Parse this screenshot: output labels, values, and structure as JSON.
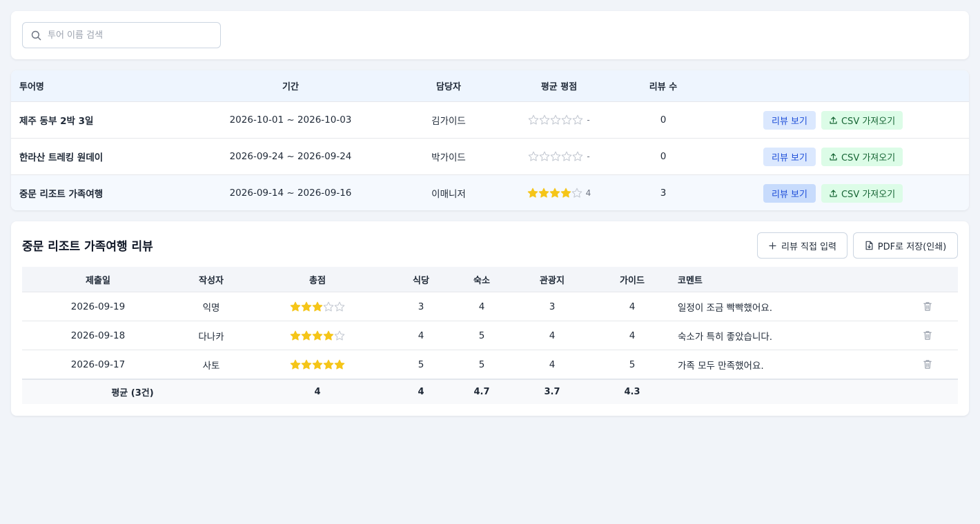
{
  "search": {
    "placeholder": "투어 이름 검색",
    "value": ""
  },
  "tours": {
    "headers": {
      "name": "투어명",
      "period": "기간",
      "manager": "담당자",
      "rating": "평균 평점",
      "count": "리뷰 수"
    },
    "view_label": "리뷰 보기",
    "csv_label": "CSV 가져오기",
    "rows": [
      {
        "name": "제주 동부 2박 3일",
        "period": "2026-10-01 ~ 2026-10-03",
        "manager": "김가이드",
        "stars": 0,
        "rating_text": "-",
        "count": "0"
      },
      {
        "name": "한라산 트레킹 원데이",
        "period": "2026-09-24 ~ 2026-09-24",
        "manager": "박가이드",
        "stars": 0,
        "rating_text": "-",
        "count": "0"
      },
      {
        "name": "중문 리조트 가족여행",
        "period": "2026-09-14 ~ 2026-09-16",
        "manager": "이매니저",
        "stars": 4,
        "rating_text": "4",
        "count": "3",
        "selected": true
      }
    ]
  },
  "reviews": {
    "title": "중문 리조트 가족여행 리뷰",
    "add_label": "리뷰 직접 입력",
    "pdf_label": "PDF로 저장(인쇄)",
    "headers": {
      "date": "제출일",
      "author": "작성자",
      "total": "총점",
      "food": "식당",
      "stay": "숙소",
      "sight": "관광지",
      "guide": "가이드",
      "comment": "코멘트"
    },
    "rows": [
      {
        "date": "2026-09-19",
        "author": "익명",
        "total": 3,
        "food": "3",
        "stay": "4",
        "sight": "3",
        "guide": "4",
        "comment": "일정이 조금 빡빡했어요."
      },
      {
        "date": "2026-09-18",
        "author": "다나카",
        "total": 4,
        "food": "4",
        "stay": "5",
        "sight": "4",
        "guide": "4",
        "comment": "숙소가 특히 좋았습니다."
      },
      {
        "date": "2026-09-17",
        "author": "사토",
        "total": 5,
        "food": "5",
        "stay": "5",
        "sight": "4",
        "guide": "5",
        "comment": "가족 모두 만족했어요."
      }
    ],
    "footer": {
      "label": "평균 (3건)",
      "total": "4",
      "food": "4",
      "stay": "4.7",
      "sight": "3.7",
      "guide": "4.3"
    }
  },
  "colors": {
    "star_filled": "#f5c518",
    "star_empty": "#c4c9d2",
    "view_bg": "#dbe8fe",
    "csv_bg": "#dcfce7"
  }
}
